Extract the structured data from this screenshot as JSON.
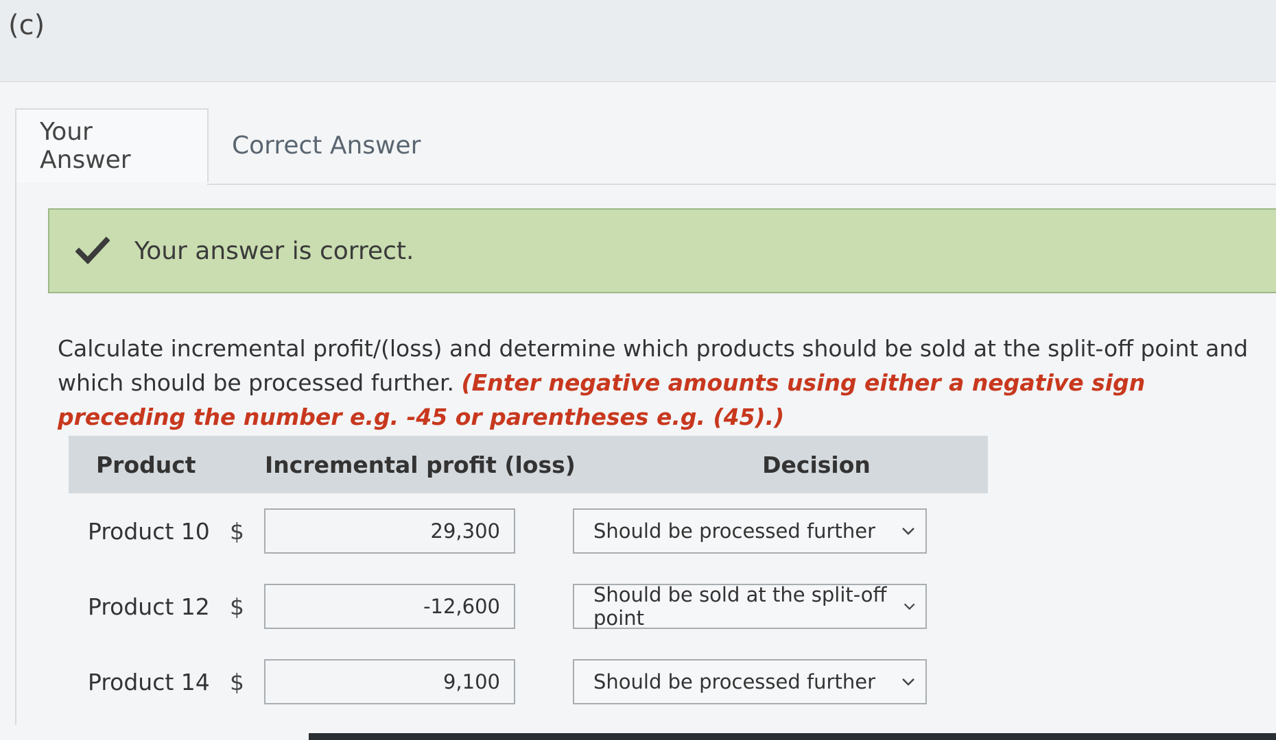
{
  "part_label": "(c)",
  "tabs": [
    {
      "label": "Your Answer",
      "active": true
    },
    {
      "label": "Correct Answer",
      "active": false
    }
  ],
  "feedback": {
    "icon": "checkmark-icon",
    "message": "Your answer is correct.",
    "color": "#c9ddb0"
  },
  "instructions": {
    "text": "Calculate incremental profit/(loss) and determine which products should be sold at the split-off point and which should be processed further.",
    "note": "(Enter negative amounts using either a negative sign preceding the number e.g. -45 or parentheses e.g. (45).)",
    "note_color": "#c8381e"
  },
  "table": {
    "headers": {
      "product": "Product",
      "profit": "Incremental profit (loss)",
      "decision": "Decision"
    },
    "currency": "$",
    "rows": [
      {
        "product": "Product 10",
        "profit": "29,300",
        "decision": "Should be processed further"
      },
      {
        "product": "Product 12",
        "profit": "-12,600",
        "decision": "Should be sold at the split-off point"
      },
      {
        "product": "Product 14",
        "profit": "9,100",
        "decision": "Should be processed further"
      }
    ]
  }
}
